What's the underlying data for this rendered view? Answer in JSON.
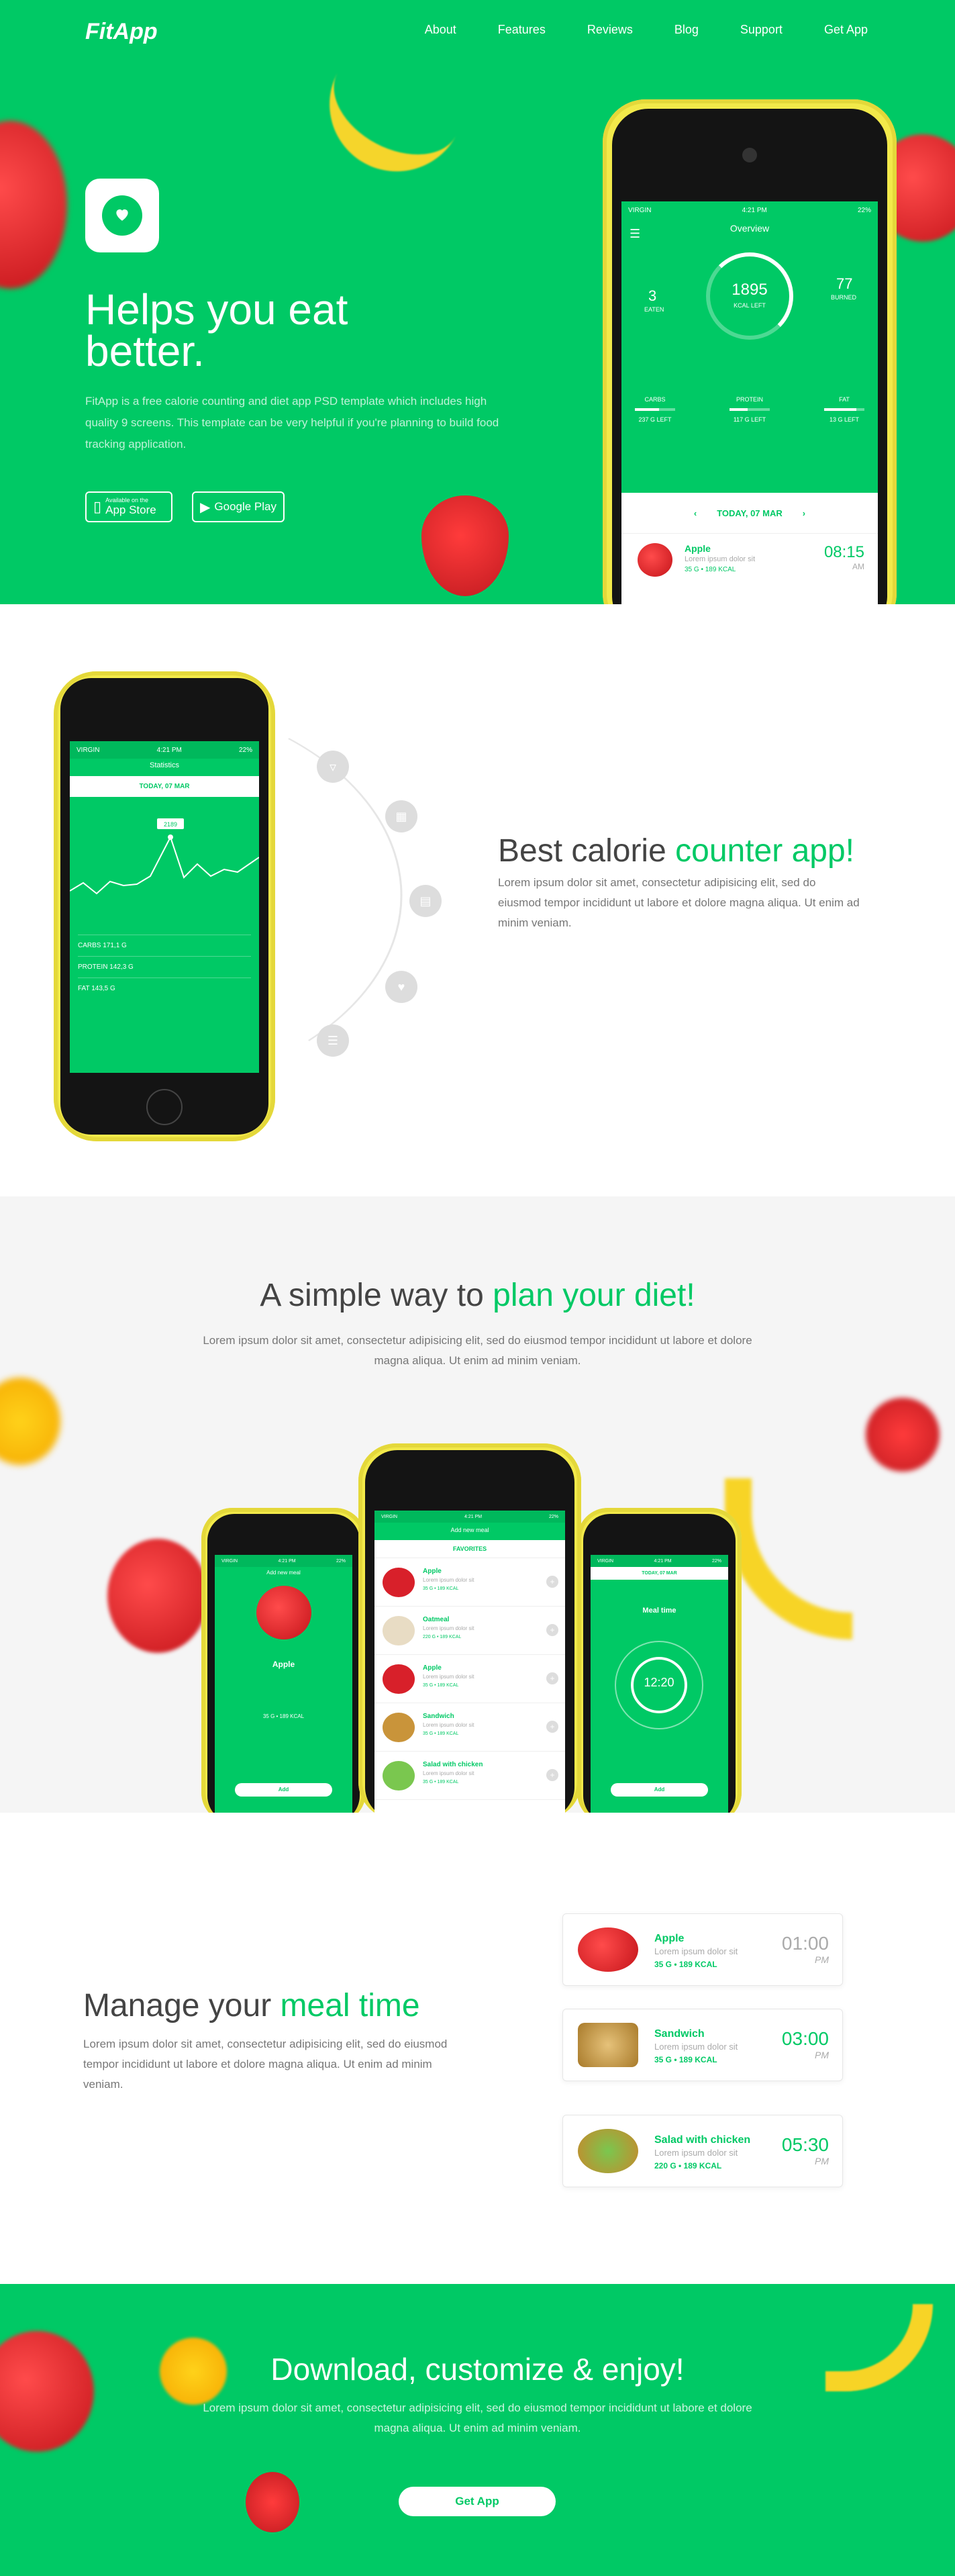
{
  "nav": {
    "logo": "FitApp",
    "links": [
      "About",
      "Features",
      "Reviews",
      "Blog",
      "Support",
      "Get App"
    ]
  },
  "hero": {
    "title_line1": "Helps you eat",
    "title_line2": "better.",
    "text": "FitApp is a free calorie counting and diet app PSD template which includes high quality 9 screens. This template can be very helpful if you're planning to build food tracking application.",
    "appstore_small": "Available on the",
    "appstore_big": "App Store",
    "googleplay": "Google Play",
    "phone": {
      "carrier": "VIRGIN",
      "time": "4:21 PM",
      "battery": "22%",
      "title": "Overview",
      "eaten_value": "3",
      "eaten_label": "EATEN",
      "kcal_value": "1895",
      "kcal_label": "KCAL LEFT",
      "burned_value": "77",
      "burned_label": "BURNED",
      "macros": [
        {
          "label": "CARBS",
          "left": "237 G LEFT"
        },
        {
          "label": "PROTEIN",
          "left": "117 G LEFT"
        },
        {
          "label": "FAT",
          "left": "13 G LEFT"
        }
      ],
      "date": "TODAY, 07 MAR",
      "meal_name": "Apple",
      "meal_desc": "Lorem ipsum dolor sit",
      "meal_meta": "35 G  •  189 KCAL",
      "meal_time": "08:15",
      "meal_ampm": "AM"
    }
  },
  "counter": {
    "title_plain": "Best calorie ",
    "title_accent": "counter app!",
    "text": "Lorem ipsum dolor sit amet, consectetur adipisicing elit, sed do eiusmod tempor incididunt ut labore et dolore magna aliqua. Ut enim ad minim veniam.",
    "phone": {
      "carrier": "VIRGIN",
      "time": "4:21 PM",
      "title": "Statistics",
      "date": "TODAY, 07 MAR",
      "tooltip": "2189",
      "rows": [
        {
          "label": "CARBS",
          "value": "171,1 G"
        },
        {
          "label": "PROTEIN",
          "value": "142,3 G"
        },
        {
          "label": "FAT",
          "value": "143,5 G"
        }
      ]
    }
  },
  "plan": {
    "title_plain": "A simple way to ",
    "title_accent": "plan your diet!",
    "text": "Lorem ipsum dolor sit amet, consectetur adipisicing elit, sed do eiusmod tempor incididunt ut labore et dolore magna aliqua. Ut enim ad minim veniam.",
    "left_phone": {
      "header": "Add new meal",
      "food": "Apple",
      "meta": "35 G  •  189 KCAL",
      "button": "Add"
    },
    "center_phone": {
      "header": "Add new meal",
      "tab": "FAVORITES",
      "items": [
        {
          "name": "Apple",
          "desc": "Lorem ipsum dolor sit",
          "meta": "35 G  •  189 KCAL"
        },
        {
          "name": "Oatmeal",
          "desc": "Lorem ipsum dolor sit",
          "meta": "220 G  •  189 KCAL"
        },
        {
          "name": "Apple",
          "desc": "Lorem ipsum dolor sit",
          "meta": "35 G  •  189 KCAL"
        },
        {
          "name": "Sandwich",
          "desc": "Lorem ipsum dolor sit",
          "meta": "35 G  •  189 KCAL"
        },
        {
          "name": "Salad with chicken",
          "desc": "Lorem ipsum dolor sit",
          "meta": "35 G  •  189 KCAL"
        }
      ]
    },
    "right_phone": {
      "date": "TODAY, 07 MAR",
      "title": "Meal time",
      "time": "12:20",
      "button": "Add"
    }
  },
  "meal": {
    "title_plain": "Manage your ",
    "title_accent": "meal time",
    "text": "Lorem ipsum dolor sit amet, consectetur adipisicing elit, sed do eiusmod tempor incididunt ut labore et dolore magna aliqua. Ut enim ad minim veniam.",
    "cards": [
      {
        "name": "Apple",
        "desc": "Lorem ipsum dolor sit",
        "meta": "35 G  •  189 KCAL",
        "time": "01:00",
        "ampm": "PM"
      },
      {
        "name": "Sandwich",
        "desc": "Lorem ipsum dolor sit",
        "meta": "35 G  •  189 KCAL",
        "time": "03:00",
        "ampm": "PM"
      },
      {
        "name": "Salad with chicken",
        "desc": "Lorem ipsum dolor sit",
        "meta": "220 G  •  189 KCAL",
        "time": "05:30",
        "ampm": "PM"
      }
    ]
  },
  "download": {
    "title": "Download, customize & enjoy!",
    "text": "Lorem ipsum dolor sit amet, consectetur adipisicing elit, sed do eiusmod tempor incididunt ut labore et dolore magna aliqua. Ut enim ad minim veniam.",
    "button": "Get App"
  },
  "colors": {
    "accent": "#00c965",
    "phone_body": "#f2e94a"
  }
}
